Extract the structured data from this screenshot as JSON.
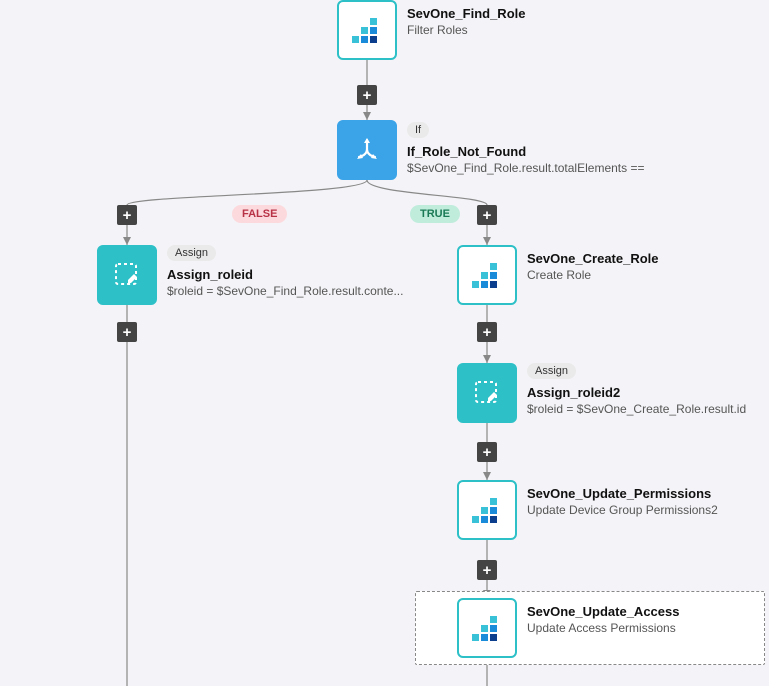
{
  "nodes": {
    "find_role": {
      "title": "SevOne_Find_Role",
      "sub": "Filter Roles"
    },
    "if_role": {
      "badge": "If",
      "title": "If_Role_Not_Found",
      "sub": "$SevOne_Find_Role.result.totalElements =="
    },
    "assign_roleid": {
      "badge": "Assign",
      "title": "Assign_roleid",
      "sub": "$roleid = $SevOne_Find_Role.result.conte..."
    },
    "create_role": {
      "title": "SevOne_Create_Role",
      "sub": "Create Role"
    },
    "assign_roleid2": {
      "badge": "Assign",
      "title": "Assign_roleid2",
      "sub": "$roleid = $SevOne_Create_Role.result.id"
    },
    "update_perm": {
      "title": "SevOne_Update_Permissions",
      "sub": "Update Device Group Permissions2"
    },
    "update_access": {
      "title": "SevOne_Update_Access",
      "sub": "Update Access Permissions"
    }
  },
  "labels": {
    "false": "FALSE",
    "true": "TRUE"
  }
}
